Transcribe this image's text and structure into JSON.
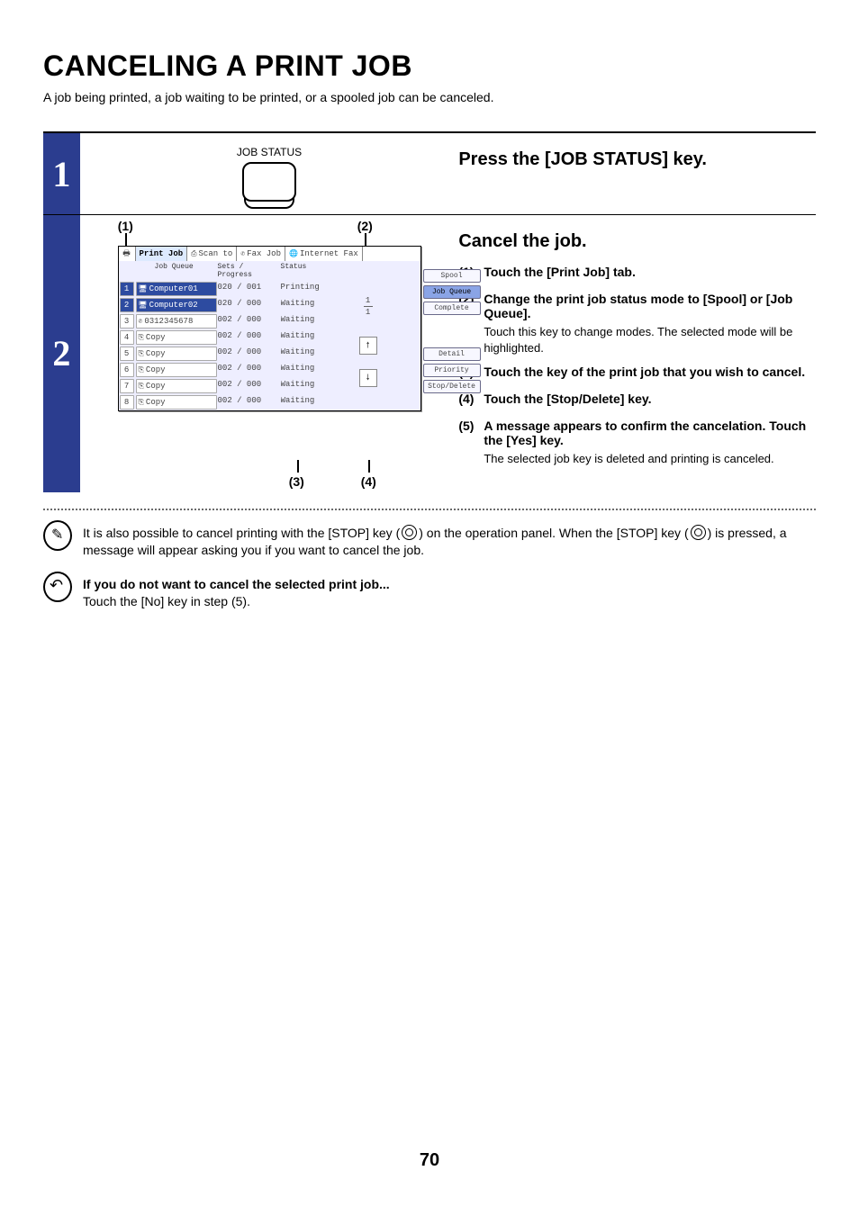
{
  "title": "CANCELING A PRINT JOB",
  "intro": "A job being printed, a job waiting to be printed, or a spooled job can be canceled.",
  "step1": {
    "key_label": "JOB STATUS",
    "heading": "Press the [JOB STATUS] key."
  },
  "step2": {
    "heading": "Cancel the job.",
    "callouts": {
      "c1": "(1)",
      "c2": "(2)",
      "c3": "(3)",
      "c4": "(4)"
    },
    "substeps": [
      {
        "num": "(1)",
        "bold": "Touch the [Print Job] tab.",
        "plain": ""
      },
      {
        "num": "(2)",
        "bold": "Change the print job status mode to [Spool] or [Job Queue].",
        "plain": "Touch this key to change modes. The selected mode will be highlighted."
      },
      {
        "num": "(3)",
        "bold": "Touch the key of the print job that you wish to cancel.",
        "plain": ""
      },
      {
        "num": "(4)",
        "bold": "Touch the [Stop/Delete] key.",
        "plain": ""
      },
      {
        "num": "(5)",
        "bold": "A message appears to confirm the cancelation. Touch the [Yes] key.",
        "plain": "The selected job key is deleted and printing is canceled."
      }
    ],
    "panel": {
      "tabs": {
        "print": "Print Job",
        "scan": "Scan to",
        "fax": "Fax Job",
        "ifax": "Internet Fax"
      },
      "list_header": {
        "name": "Job Queue",
        "sets": "Sets / Progress",
        "status": "Status"
      },
      "rows": [
        {
          "idx": "1",
          "name": "Computer01",
          "prog": "020 / 001",
          "status": "Printing",
          "sel": true,
          "ic": "pc"
        },
        {
          "idx": "2",
          "name": "Computer02",
          "prog": "020 / 000",
          "status": "Waiting",
          "sel": true,
          "ic": "pc"
        },
        {
          "idx": "3",
          "name": "0312345678",
          "prog": "002 / 000",
          "status": "Waiting",
          "sel": false,
          "ic": "phone"
        },
        {
          "idx": "4",
          "name": "Copy",
          "prog": "002 / 000",
          "status": "Waiting",
          "sel": false,
          "ic": "copy"
        },
        {
          "idx": "5",
          "name": "Copy",
          "prog": "002 / 000",
          "status": "Waiting",
          "sel": false,
          "ic": "copy"
        },
        {
          "idx": "6",
          "name": "Copy",
          "prog": "002 / 000",
          "status": "Waiting",
          "sel": false,
          "ic": "copy"
        },
        {
          "idx": "7",
          "name": "Copy",
          "prog": "002 / 000",
          "status": "Waiting",
          "sel": false,
          "ic": "copy"
        },
        {
          "idx": "8",
          "name": "Copy",
          "prog": "002 / 000",
          "status": "Waiting",
          "sel": false,
          "ic": "copy"
        }
      ],
      "page": {
        "top": "1",
        "bottom": "1"
      },
      "side": {
        "spool": "Spool",
        "jobqueue": "Job Queue",
        "complete": "Complete",
        "detail": "Detail",
        "priority": "Priority",
        "stopdel": "Stop/Delete"
      }
    }
  },
  "notes": {
    "pencil_pre": "It is also possible to cancel printing with the [STOP] key (",
    "pencil_mid": ") on the operation panel. When the [STOP] key (",
    "pencil_post": ") is pressed, a message will appear asking you if you want to cancel the job.",
    "back_bold": "If you do not want to cancel the selected print job...",
    "back_plain": "Touch the [No] key in step (5)."
  },
  "page_number": "70"
}
